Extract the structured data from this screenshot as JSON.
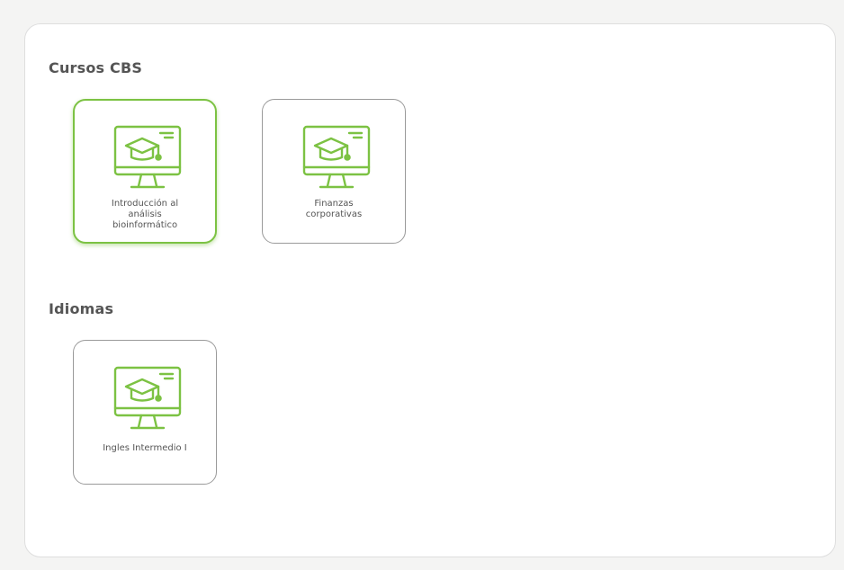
{
  "accent_color": "#7cc243",
  "sections": [
    {
      "title": "Cursos CBS",
      "courses": [
        {
          "label": "Introducción al\nanálisis\nbioinformático",
          "icon": "graduation-monitor-icon",
          "selected": true
        },
        {
          "label": "Finanzas\ncorporativas",
          "icon": "graduation-monitor-icon",
          "selected": false
        }
      ]
    },
    {
      "title": "Idiomas",
      "courses": [
        {
          "label": "Ingles Intermedio I",
          "icon": "graduation-monitor-icon",
          "selected": false
        }
      ]
    }
  ]
}
